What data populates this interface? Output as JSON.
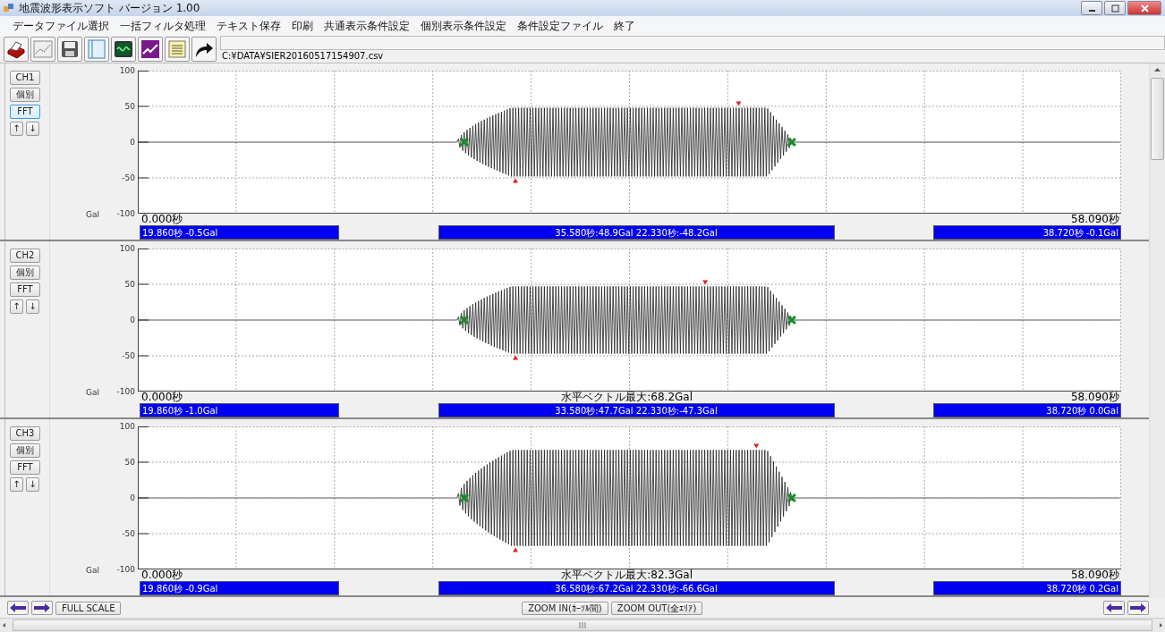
{
  "window": {
    "title": "地震波形表示ソフト バージョン 1.00"
  },
  "menu": [
    "データファイル選択",
    "一括フィルタ処理",
    "テキスト保存",
    "印刷",
    "共通表示条件設定",
    "個別表示条件設定",
    "条件設定ファイル",
    "終了"
  ],
  "toolbar": {
    "file_path": "C:¥DATA¥SIER20160517154907.csv"
  },
  "channels": [
    {
      "channel_button": "CH1",
      "individual_button": "個別",
      "fft_button": "FFT",
      "fft_focused": true,
      "up_button": "↑",
      "down_button": "↓",
      "unit": "Gal",
      "y_ticks": [
        "100",
        "50",
        "0",
        "-50",
        "-100"
      ],
      "start_time": "0.000秒",
      "end_time": "58.090秒",
      "left_reading": "19.860秒 -0.5Gal",
      "center_reading": "35.580秒:48.9Gal 22.330秒:-48.2Gal",
      "right_reading": "38.720秒 -0.1Gal"
    },
    {
      "channel_button": "CH2",
      "individual_button": "個別",
      "fft_button": "FFT",
      "fft_focused": false,
      "up_button": "↑",
      "down_button": "↓",
      "unit": "Gal",
      "y_ticks": [
        "100",
        "50",
        "0",
        "-50",
        "-100"
      ],
      "start_time": "0.000秒",
      "vector_max": "水平ベクトル最大:68.2Gal",
      "end_time": "58.090秒",
      "left_reading": "19.860秒 -1.0Gal",
      "center_reading": "33.580秒:47.7Gal 22.330秒:-47.3Gal",
      "right_reading": "38.720秒 0.0Gal"
    },
    {
      "channel_button": "CH3",
      "individual_button": "個別",
      "fft_button": "FFT",
      "fft_focused": false,
      "up_button": "↑",
      "down_button": "↓",
      "unit": "Gal",
      "y_ticks": [
        "100",
        "50",
        "0",
        "-50",
        "-100"
      ],
      "start_time": "0.000秒",
      "vector_max": "水平ベクトル最大:82.3Gal",
      "end_time": "58.090秒",
      "left_reading": "19.860秒 -0.9Gal",
      "center_reading": "36.580秒:67.2Gal 22.330秒:-66.6Gal",
      "right_reading": "38.720秒 0.2Gal"
    }
  ],
  "bottom_bar": {
    "full_scale_button": "FULL SCALE",
    "zoom_in_button": "ZOOM IN(ｶｰｿﾙ間)",
    "zoom_out_button": "ZOOM OUT(全ｴﾘｱ)"
  }
}
